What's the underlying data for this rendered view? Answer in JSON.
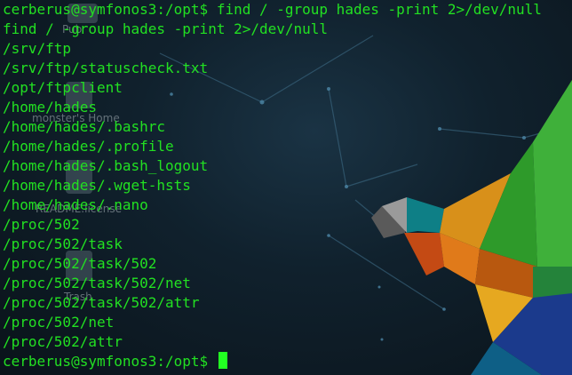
{
  "desktop": {
    "icons": [
      {
        "name": "ftp-folder",
        "label": "Pub"
      },
      {
        "name": "home-folder",
        "label": "monster's Home"
      },
      {
        "name": "license-file",
        "label": "README.license"
      },
      {
        "name": "trash",
        "label": "Trash"
      }
    ],
    "accent_colors": {
      "terminal_text": "#22e022",
      "cursor": "#22ff22",
      "bird_orange": "#e07a1a",
      "bird_green": "#2e9a2a",
      "bird_teal": "#0e7f86",
      "bird_blue": "#1b3a8c"
    }
  },
  "terminal": {
    "lines": [
      "cerberus@symfonos3:/opt$ find / -group hades -print 2>/dev/null",
      "find / -group hades -print 2>/dev/null",
      "/srv/ftp",
      "/srv/ftp/statuscheck.txt",
      "/opt/ftpclient",
      "/home/hades",
      "/home/hades/.bashrc",
      "/home/hades/.profile",
      "/home/hades/.bash_logout",
      "/home/hades/.wget-hsts",
      "/home/hades/.nano",
      "/proc/502",
      "/proc/502/task",
      "/proc/502/task/502",
      "/proc/502/task/502/net",
      "/proc/502/task/502/attr",
      "/proc/502/net",
      "/proc/502/attr"
    ],
    "prompt": "cerberus@symfonos3:/opt$ "
  }
}
